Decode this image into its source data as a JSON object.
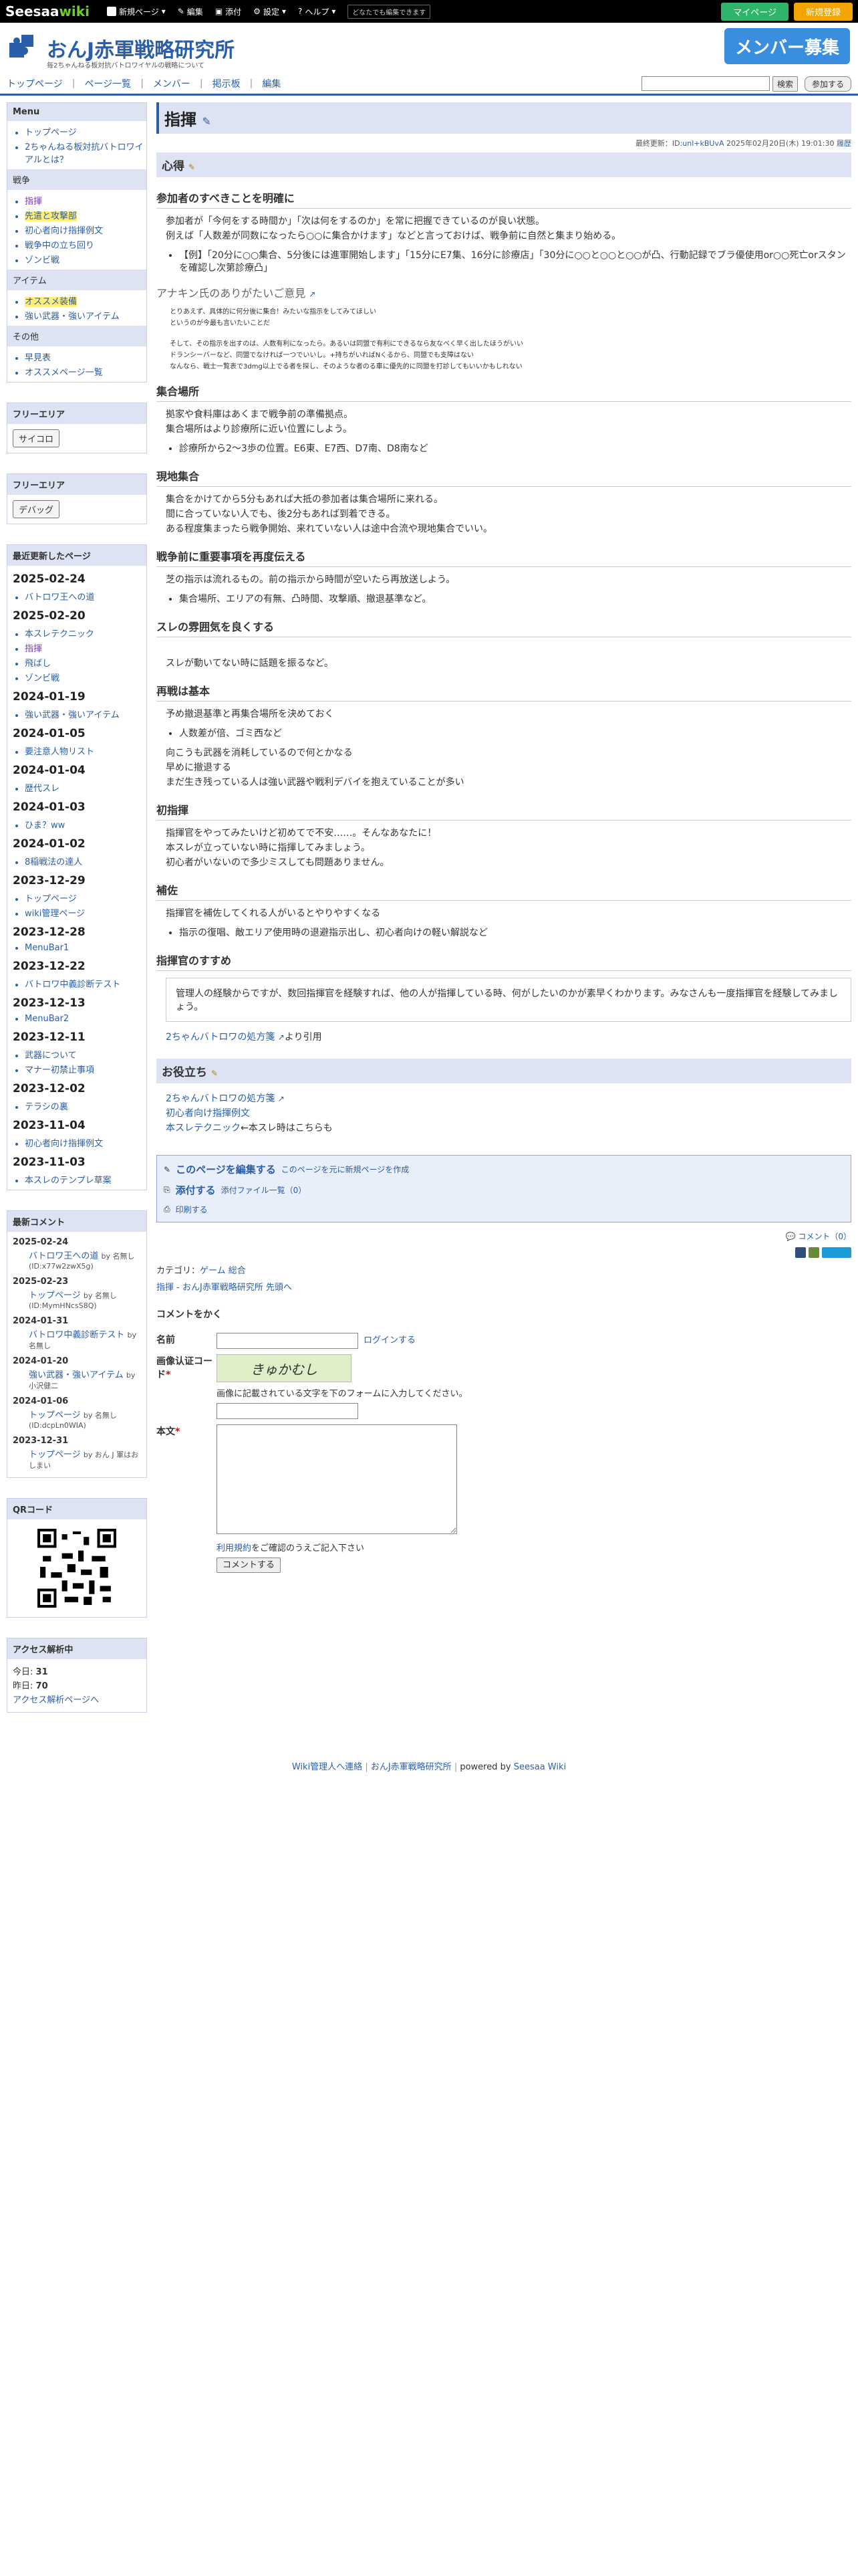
{
  "topbar": {
    "logo_main": "Seesaa",
    "logo_wiki": "wiki",
    "new_page": "新規ページ",
    "edit": "編集",
    "attach": "添付",
    "settings": "設定",
    "help": "ヘルプ",
    "note": "どなたでも編集できます",
    "mypage": "マイページ",
    "register": "新規登録"
  },
  "header": {
    "title": "おんJ赤軍戦略研究所",
    "subtitle": "毎2ちゃんねる板対抗バトロワイヤルの戦略について",
    "banner": "メンバー募集"
  },
  "nav": {
    "items": [
      "トップページ",
      "ページ一覧",
      "メンバー",
      "掲示板",
      "編集"
    ],
    "search_button": "検索",
    "join_button": "参加する"
  },
  "sidebar": {
    "menu_title": "Menu",
    "menu_items": [
      "トップページ",
      "2ちゃんねる板対抗バトロワイアルとは？"
    ],
    "section_battle": "戦争",
    "battle_items": [
      "指揮",
      "先遣と攻撃部",
      "初心者向け指揮例文",
      "戦争中の立ち回り",
      "ゾンビ戦"
    ],
    "section_item": "アイテム",
    "item_items": [
      "オススメ装備",
      "強い武器・強いアイテム"
    ],
    "section_other": "その他",
    "other_items": [
      "早見表",
      "オススメページ一覧"
    ],
    "free_title_1": "フリーエリア",
    "free_button_1": "サイコロ",
    "free_title_2": "フリーエリア",
    "free_button_2": "デバッグ",
    "recent_title": "最近更新したページ",
    "recent": [
      {
        "date": "2025-02-24",
        "items": [
          "バトロワ王への道"
        ]
      },
      {
        "date": "2025-02-20",
        "items": [
          "本スレテクニック",
          "指揮",
          "飛ばし",
          "ゾンビ戦"
        ]
      },
      {
        "date": "2024-01-19",
        "items": [
          "強い武器・強いアイテム"
        ]
      },
      {
        "date": "2024-01-05",
        "items": [
          "要注意人物リスト"
        ]
      },
      {
        "date": "2024-01-04",
        "items": [
          "歴代スレ"
        ]
      },
      {
        "date": "2024-01-03",
        "items": [
          "ひま？ww"
        ]
      },
      {
        "date": "2024-01-02",
        "items": [
          "8稲戦法の達人"
        ]
      },
      {
        "date": "2023-12-29",
        "items": [
          "トップページ",
          "wiki管理ページ"
        ]
      },
      {
        "date": "2023-12-28",
        "items": [
          "MenuBar1"
        ]
      },
      {
        "date": "2023-12-22",
        "items": [
          "バトロワ中義診断テスト"
        ]
      },
      {
        "date": "2023-12-13",
        "items": [
          "MenuBar2"
        ]
      },
      {
        "date": "2023-12-11",
        "items": [
          "武器について",
          "マナー初禁止事項"
        ]
      },
      {
        "date": "2023-12-02",
        "items": [
          "テラシの裏"
        ]
      },
      {
        "date": "2023-11-04",
        "items": [
          "初心者向け指揮例文"
        ]
      },
      {
        "date": "2023-11-03",
        "items": [
          "本スレのテンプレ草案"
        ]
      }
    ],
    "comment_title": "最新コメント",
    "comments": [
      {
        "date": "2025-02-24",
        "item": "バトロワ王への道",
        "by": "by 名無し(ID:x77w2zwX5g)"
      },
      {
        "date": "2025-02-23",
        "item": "トップページ",
        "by": "by 名無し(ID:MymHNcsS8Q)"
      },
      {
        "date": "2024-01-31",
        "item": "バトロワ中義診断テスト",
        "by": "by 名無し"
      },
      {
        "date": "2024-01-20",
        "item": "強い武器・強いアイテム",
        "by": "by 小沢健二"
      },
      {
        "date": "2024-01-06",
        "item": "トップページ",
        "by": "by 名無し(ID:dcpLn0WIA)"
      },
      {
        "date": "2023-12-31",
        "item": "トップページ",
        "by": "by おん J 軍はおしまい"
      }
    ],
    "qr_title": "QRコード",
    "access_title": "アクセス解析中",
    "today_label": "今日:",
    "today_value": "31",
    "yesterday_label": "昨日:",
    "yesterday_value": "70",
    "access_link": "アクセス解析ページへ"
  },
  "main": {
    "title": "指揮",
    "updated_label": "最終更新：ID:",
    "updated_id": "unl+kBUvA",
    "updated_date": "2025年02月20日(木) 19:01:30",
    "history": "履歴",
    "kokoroe": "心得",
    "s1_title": "参加者のすべきことを明確に",
    "s1_lines": [
      "参加者が「今何をする時間か」「次は何をするのか」を常に把握できているのが良い状態。",
      "例えば「人数差が同数になったら○○に集合かけます」などと言っておけば、戦争前に自然と集まり始める。"
    ],
    "s1_bullet": "【例】「20分に○○集合、5分後には進軍開始します」「15分にE7集、16分に診療店」「30分に○○と○○と○○が凸、行動記録でブラ優使用or○○死亡orスタンを確認し次第診療凸」",
    "opinion_title": "アナキン氏のありがたいご意見",
    "opinion_lines": [
      "とりあえず、具体的に何分後に集合！みたいな指示をしてみてほしい",
      "というのが今最も言いたいことだ",
      "",
      "そして、その指示を出すのは、人数有利になったら。あるいは同盟で有利にできるなら友なべく早く出したほうがいい",
      "ドランシーバーなど、同盟でなければ一つでいいし。+持ちがいればNくるから、同盟でも支障はない",
      "なんなら、戦士一覧表で3dmg以上でる者を探し、そのような者のる車に優先的に同盟を打診してもいいかもしれない"
    ],
    "s2_title": "集合場所",
    "s2_lines": [
      "拠家や食料庫はあくまで戦争前の準備拠点。",
      "集合場所はより診療所に近い位置にしよう。"
    ],
    "s2_bullet": "診療所から2～3歩の位置。E6東、E7西、D7南、D8南など",
    "s3_title": "現地集合",
    "s3_lines": [
      "集合をかけてから5分もあれば大抵の参加者は集合場所に来れる。",
      "間に合っていない人でも、後2分もあれば到着できる。",
      "ある程度集まったら戦争開始、来れていない人は途中合流や現地集合でいい。"
    ],
    "s4_title": "戦争前に重要事項を再度伝える",
    "s4_lines": [
      "芝の指示は流れるもの。前の指示から時間が空いたら再放送しよう。"
    ],
    "s4_bullet": "集合場所、エリアの有無、凸時間、攻撃順、撤退基準など。",
    "s5_title": "スレの雰囲気を良くする",
    "s5_lines": [
      "スレが動いてない時に話題を振るなど。"
    ],
    "s6_title": "再戦は基本",
    "s6_lines": [
      "予め撤退基準と再集合場所を決めておく"
    ],
    "s6_bullet": "人数差が倍、ゴミ西など",
    "s6_lines2": [
      "向こうも武器を消耗しているので何とかなる",
      "早めに撤退する",
      "まだ生き残っている人は強い武器や戦利デバイを抱えていることが多い"
    ],
    "s7_title": "初指揮",
    "s7_lines": [
      "指揮官をやってみたいけど初めてで不安……。そんなあなたに！",
      "本スレが立っていない時に指揮してみましょう。",
      "初心者がいないので多少ミスしても問題ありません。"
    ],
    "s8_title": "補佐",
    "s8_lines": [
      "指揮官を補佐してくれる人がいるとやりやすくなる"
    ],
    "s8_bullet": "指示の復唱、敵エリア使用時の退避指示出し、初心者向けの軽い解説など",
    "s9_title": "指揮官のすすめ",
    "s9_quote": "管理人の経験からですが、数回指揮官を経験すれば、他の人が指揮している時、何がしたいのかが素早くわかります。みなさんも一度指揮官を経験してみましょう。",
    "s9_cite_link": "2ちゃんバトロワの処方箋",
    "s9_cite_tail": "より引用",
    "useful_title": "お役立ち",
    "useful_links": [
      "2ちゃんバトロワの処方箋",
      "初心者向け指揮例文",
      "本スレテクニック"
    ],
    "useful_tail": "←本スレ時はこちらも",
    "edit_this": "このページを編集する",
    "edit_new": "このページを元に新規ページを作成",
    "attach": "添付する",
    "attach_list": "添付ファイル一覧（0）",
    "print": "印刷する",
    "comment_count": "コメント（0）",
    "category_label": "カテゴリ：",
    "categories": [
      "ゲーム",
      "総合"
    ],
    "breadcrumb": "指揮 - おんJ赤軍戦略研究所 先頭へ",
    "comment_form_title": "コメントをかく",
    "name_label": "名前",
    "login_link": "ログインする",
    "captcha_label": "画像认证コード",
    "captcha_text": "きゅかむし",
    "captcha_hint": "画像に記載されている文字を下のフォームに入力してください。",
    "body_label": "本文",
    "terms_link": "利用規約",
    "terms_tail": "をご確認のうえご記入下さい",
    "submit": "コメントする"
  },
  "footer": {
    "contact": "Wiki管理人へ連絡",
    "site": "おんJ赤軍戦略研究所",
    "powered": "powered by",
    "seesaa": "Seesaa Wiki"
  },
  "colors": {
    "accent": "#2a5ea8",
    "section_bg": "#dde3f3",
    "topbar": "#000000",
    "mypage_btn": "#2eb56b",
    "register_btn": "#f2a400"
  }
}
